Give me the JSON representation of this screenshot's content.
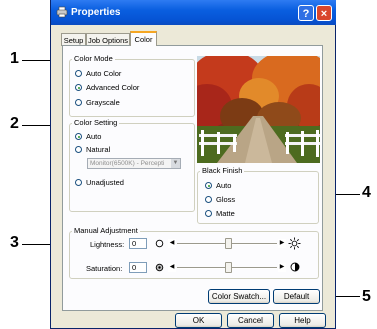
{
  "window": {
    "title": "Properties",
    "help_button": "?",
    "close_button": "×"
  },
  "tabs": [
    {
      "label": "Setup"
    },
    {
      "label": "Job Options"
    },
    {
      "label": "Color"
    }
  ],
  "color_mode": {
    "legend": "Color Mode",
    "options": [
      {
        "label": "Auto Color"
      },
      {
        "label": "Advanced Color"
      },
      {
        "label": "Grayscale"
      }
    ],
    "selected": "Advanced Color"
  },
  "color_setting": {
    "legend": "Color Setting",
    "options": [
      {
        "label": "Auto"
      },
      {
        "label": "Natural"
      },
      {
        "label": "Unadjusted"
      }
    ],
    "selected": "Auto",
    "profile_select": {
      "value": "Monitor(6500K) - Percepti"
    }
  },
  "black_finish": {
    "legend": "Black Finish",
    "options": [
      {
        "label": "Auto"
      },
      {
        "label": "Gloss"
      },
      {
        "label": "Matte"
      }
    ],
    "selected": "Auto"
  },
  "manual_adjustment": {
    "legend": "Manual Adjustment",
    "lightness": {
      "label": "Lightness:",
      "value": "0"
    },
    "saturation": {
      "label": "Saturation:",
      "value": "0"
    }
  },
  "buttons": {
    "color_swatch": "Color Swatch...",
    "default": "Default",
    "ok": "OK",
    "cancel": "Cancel",
    "help": "Help"
  },
  "callouts": {
    "c1": "1",
    "c2": "2",
    "c3": "3",
    "c4": "4",
    "c5": "5"
  },
  "colors": {
    "titlebar": "#0a5fe0",
    "dialog_bg": "#ece9d8",
    "panel_bg": "#fcfcfe",
    "accent_tab": "#f5a623"
  }
}
